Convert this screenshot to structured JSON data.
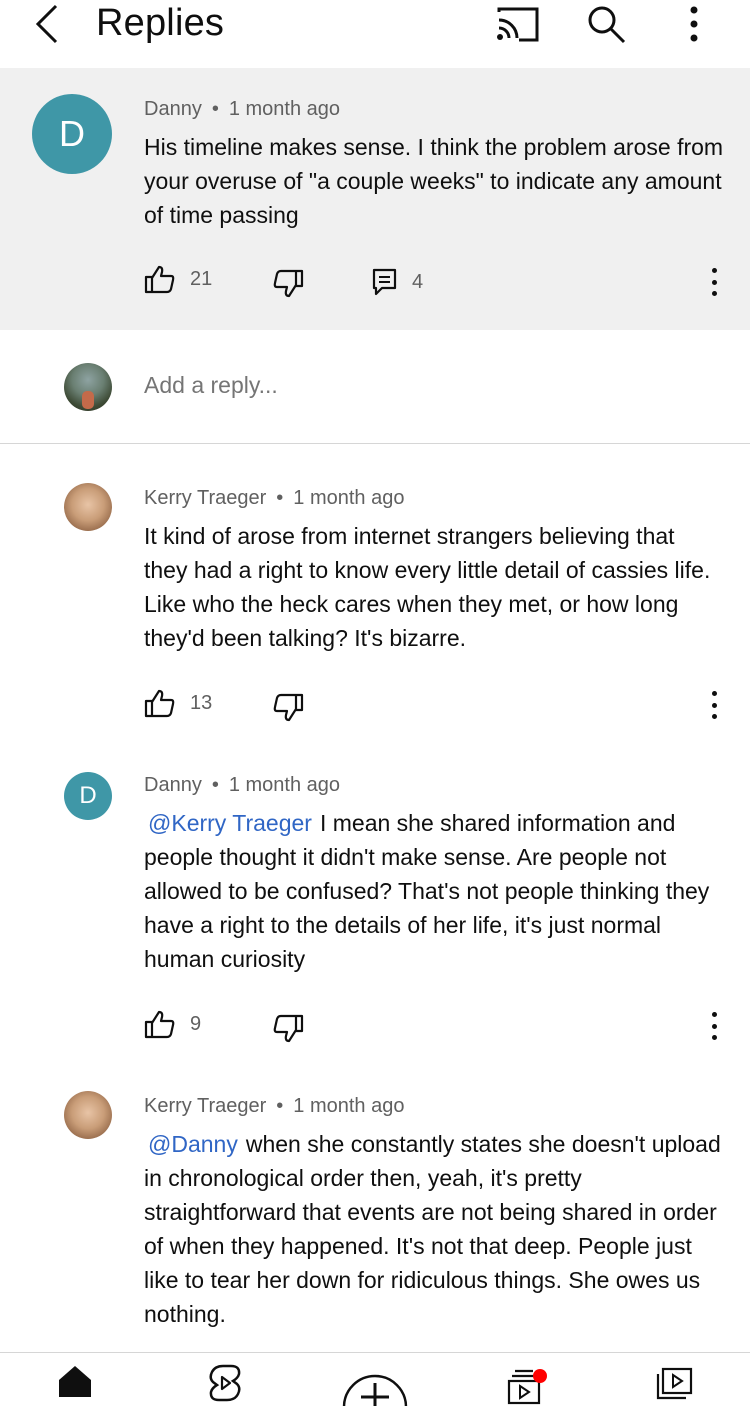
{
  "header": {
    "title": "Replies",
    "icons": [
      "back-arrow-icon",
      "cast-icon",
      "search-icon",
      "more-vertical-icon"
    ]
  },
  "parent_comment": {
    "avatar_letter": "D",
    "author": "Danny",
    "time": "1 month ago",
    "text": "His timeline makes sense.  I think the problem arose from your overuse of \"a couple weeks\" to indicate any amount of time passing",
    "likes": "21",
    "replies": "4"
  },
  "reply_box": {
    "placeholder": "Add a reply..."
  },
  "replies": [
    {
      "author": "Kerry Traeger",
      "time": "1 month ago",
      "mention": "",
      "text": "It kind of arose from internet strangers believing that they had a right to know every little detail of cassies life. Like who the heck cares when they met, or how long they'd been talking? It's bizarre.",
      "likes": "13"
    },
    {
      "avatar_letter": "D",
      "author": "Danny",
      "time": "1 month ago",
      "mention": "@Kerry Traeger",
      "text": "I mean she shared information and people thought it didn't make sense.  Are people not allowed to be confused?  That's not people thinking they have a right to the details of her life, it's just normal human curiosity",
      "likes": "9"
    },
    {
      "author": "Kerry Traeger",
      "time": "1 month ago",
      "mention": "@Danny",
      "text": "when she constantly states she doesn't upload in chronological order then, yeah, it's pretty straightforward that events are not being shared in order of when they happened. It's not that deep. People just like to tear her down for ridiculous things. She owes us nothing."
    }
  ],
  "bottom_nav": {
    "items": [
      "home-icon",
      "shorts-icon",
      "create-icon",
      "subscriptions-icon",
      "library-icon"
    ]
  },
  "colors": {
    "avatar_teal": "#3f97a7",
    "mention_blue": "#3066c5",
    "highlight_bg": "#f0f0f0",
    "notification_red": "#ff0000"
  }
}
